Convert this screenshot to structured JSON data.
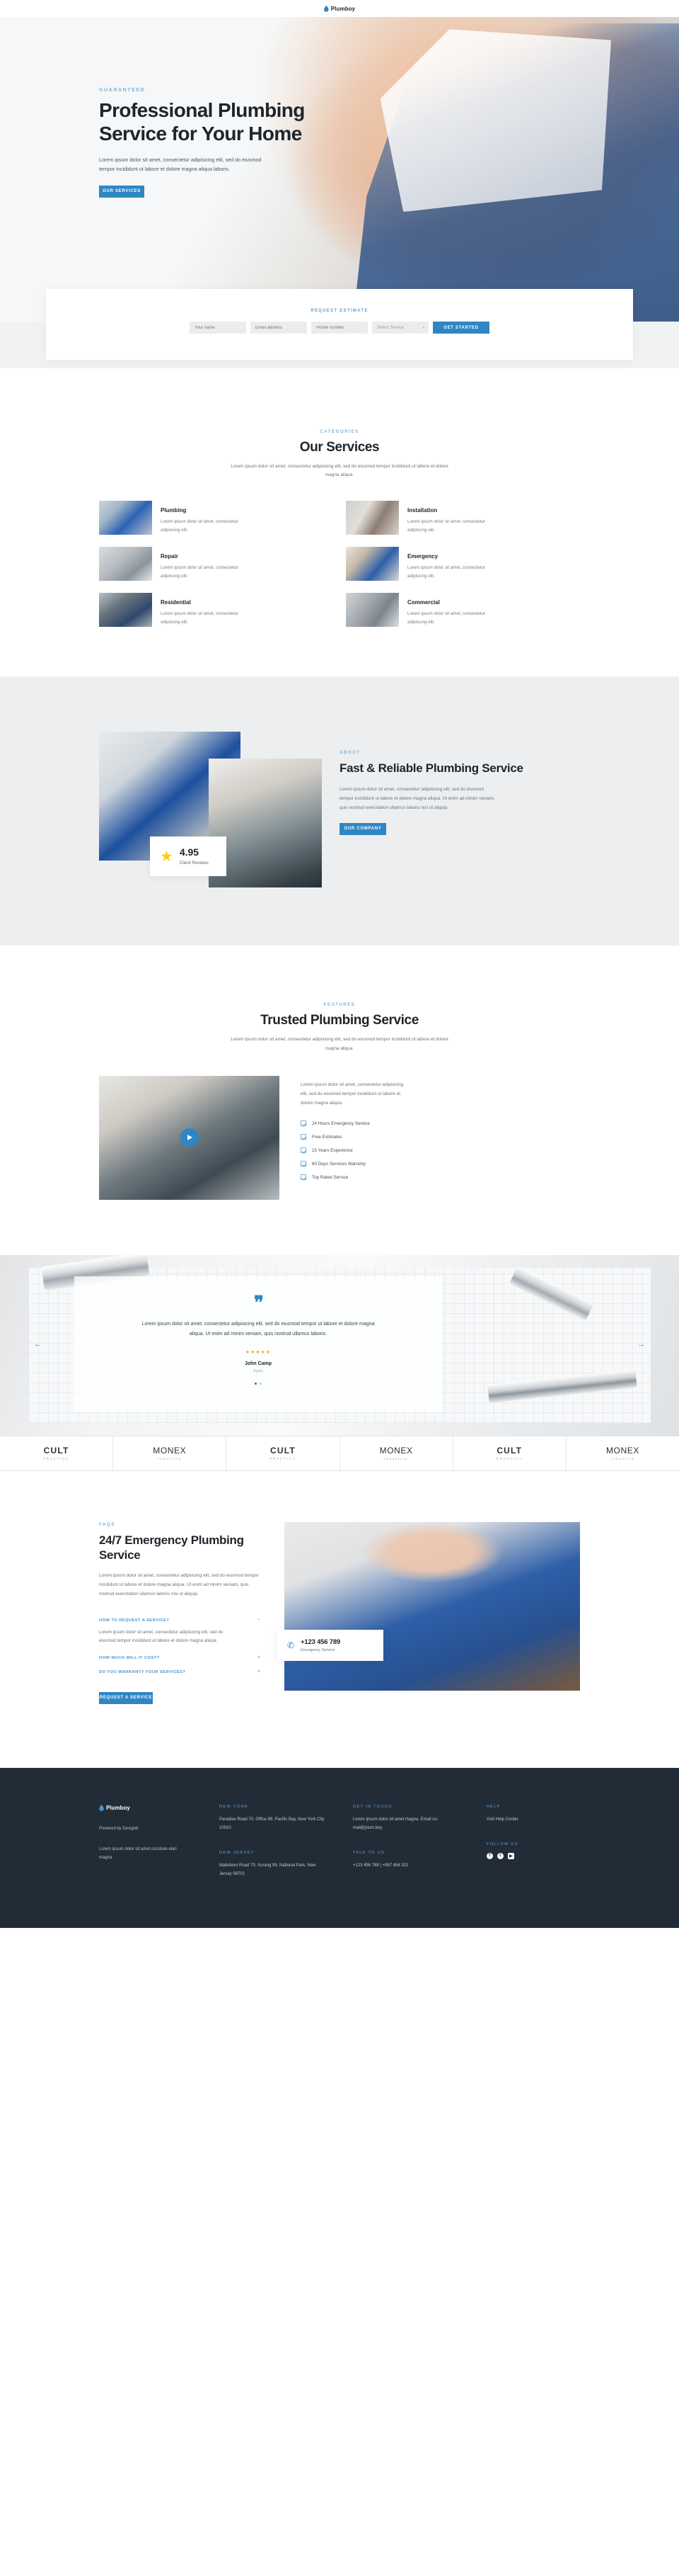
{
  "brand": {
    "name": "Plumboy",
    "icon": "water-drop-icon"
  },
  "hero": {
    "eyebrow": "GUARANTEED",
    "title": "Professional Plumbing Service for Your Home",
    "paragraph": "Lorem ipsum dolor sit amet, consectetur adipisicing elit, sed do eiusmod tempor incididunt ut labore et dolore magna aliqua laboris.",
    "cta": "OUR SERVICES"
  },
  "estimate": {
    "label": "REQUEST ESTIMATE",
    "name_placeholder": "Your name",
    "email_placeholder": "Email address",
    "phone_placeholder": "Phone number",
    "service_placeholder": "Select Service",
    "submit": "GET STARTED"
  },
  "services": {
    "eyebrow": "CATEGORIES",
    "title": "Our Services",
    "subtitle": "Lorem ipsum dolor sit amet, consectetur adipisicing elit, sed do eiusmod tempor incididunt ut labore et dolore magna aliqua.",
    "items": [
      {
        "title": "Plumbing",
        "text": "Lorem ipsum dolor sit amet, consectetur adipiscing elit."
      },
      {
        "title": "Installation",
        "text": "Lorem ipsum dolor sit amet, consectetur adipiscing elit."
      },
      {
        "title": "Repair",
        "text": "Lorem ipsum dolor sit amet, consectetur adipiscing elit."
      },
      {
        "title": "Emergency",
        "text": "Lorem ipsum dolor sit amet, consectetur adipiscing elit."
      },
      {
        "title": "Residential",
        "text": "Lorem ipsum dolor sit amet, consectetur adipiscing elit."
      },
      {
        "title": "Commercial",
        "text": "Lorem ipsum dolor sit amet, consectetur adipiscing elit."
      }
    ]
  },
  "about": {
    "eyebrow": "ABOUT",
    "title": "Fast & Reliable Plumbing Service",
    "paragraph": "Lorem ipsum dolor sit amet, consectetur adipisicing elit, sed do eiusmod tempor incididunt ut labore et dolore magna aliqua. Ut enim ad minim veniam, quis nostrud exercitation ullamco laboris nisi ut aliquip.",
    "cta": "OUR COMPANY",
    "rating_value": "4.95",
    "rating_label": "Client Reviews",
    "rating_star": "★"
  },
  "features": {
    "eyebrow": "FEATURES",
    "title": "Trusted Plumbing Service",
    "subtitle": "Lorem ipsum dolor sit amet, consectetur adipisicing elit, sed do eiusmod tempor incididunt ut labore et dolore magna aliqua.",
    "paragraph": "Lorem ipsum dolor sit amet, consectetur adipisicing elit, sed do eiusmod tempor incididunt ut labore et dolore magna aliqua.",
    "list": [
      "24 Hours Emergency Service",
      "Free Estimates",
      "15 Years Experience",
      "60 Days Services Warranty",
      "Top Rated Service"
    ]
  },
  "testimonial": {
    "quote_glyph": "❞",
    "text": "Lorem ipsum dolor sit amet, consectetur adipisicing elit, sed do eiusmod tempor ut labore et dolore magna aliqua. Ut enim ad minim veniam, quis nostrud ullamco laboris.",
    "stars": "★★★★★",
    "author": "John Camp",
    "role": "Apple",
    "prev": "←",
    "next": "→"
  },
  "logos": [
    {
      "main": "CULT",
      "sub": "PRACTICA",
      "style": "bold"
    },
    {
      "main": "MONEX",
      "sub": "industria",
      "style": "thin"
    },
    {
      "main": "CULT",
      "sub": "PRACTICA",
      "style": "bold"
    },
    {
      "main": "MONEX",
      "sub": "industria",
      "style": "thin"
    },
    {
      "main": "CULT",
      "sub": "PRACTICA",
      "style": "bold"
    },
    {
      "main": "MONEX",
      "sub": "industria",
      "style": "thin"
    }
  ],
  "faq": {
    "eyebrow": "FAQS",
    "title": "24/7 Emergency Plumbing Service",
    "paragraph": "Lorem ipsum dolor sit amet, consectetur adipisicing elit, sed do eiusmod tempor incididunt ut labore et dolore magna aliqua. Ut enim ad minim veniam, quis nostrud exercitation ullamco laboris nisi ut aliquip.",
    "items": [
      {
        "question": "HOW TO REQUEST A SERVICE?",
        "sign": "−",
        "answer": "Lorem ipsum dolor sit amet, consectetur adipisicing elit, sed do eiusmod tempor incididunt ut labore et dolore magna aliqua."
      },
      {
        "question": "HOW MUCH WILL IT COST?",
        "sign": "+",
        "answer": ""
      },
      {
        "question": "DO YOU WARRANTY YOUR SERVICES?",
        "sign": "+",
        "answer": ""
      }
    ],
    "cta": "REQUEST A SERVICE",
    "phone": "+123 456 789",
    "phone_label": "Emergency Service",
    "phone_icon": "✆"
  },
  "footer": {
    "brand": "Plumboy",
    "powered": "Powered by Design8.",
    "about": "Lorem ipsum dolor sit amet constute elari magna.",
    "col2": {
      "head1": "NEW YORK",
      "text1": "Paradise Road 70, Office 99, Pacific Bay,  New York City 10010",
      "head2": "NEW JERSEY",
      "text2": "Malioboro Road 70, Xurang 99, National Park, New Jersey 08701"
    },
    "col3": {
      "head1": "GET IN TOUCH",
      "text1": "Lorem ipsum dolor sit amet magna. Email us: mail@plum.boy",
      "head2": "TALK TO US",
      "text2": "+123 456 789 | +987 654 321"
    },
    "col4": {
      "head1": "HELP",
      "text1": "Visit Help Center",
      "head2": "FOLLOW US",
      "socials": [
        "f",
        "t",
        "▶"
      ]
    }
  },
  "colors": {
    "accent": "#2f86c5",
    "dark": "#222c36",
    "light_blue": "#7fb2d6",
    "star": "#f7d117"
  }
}
